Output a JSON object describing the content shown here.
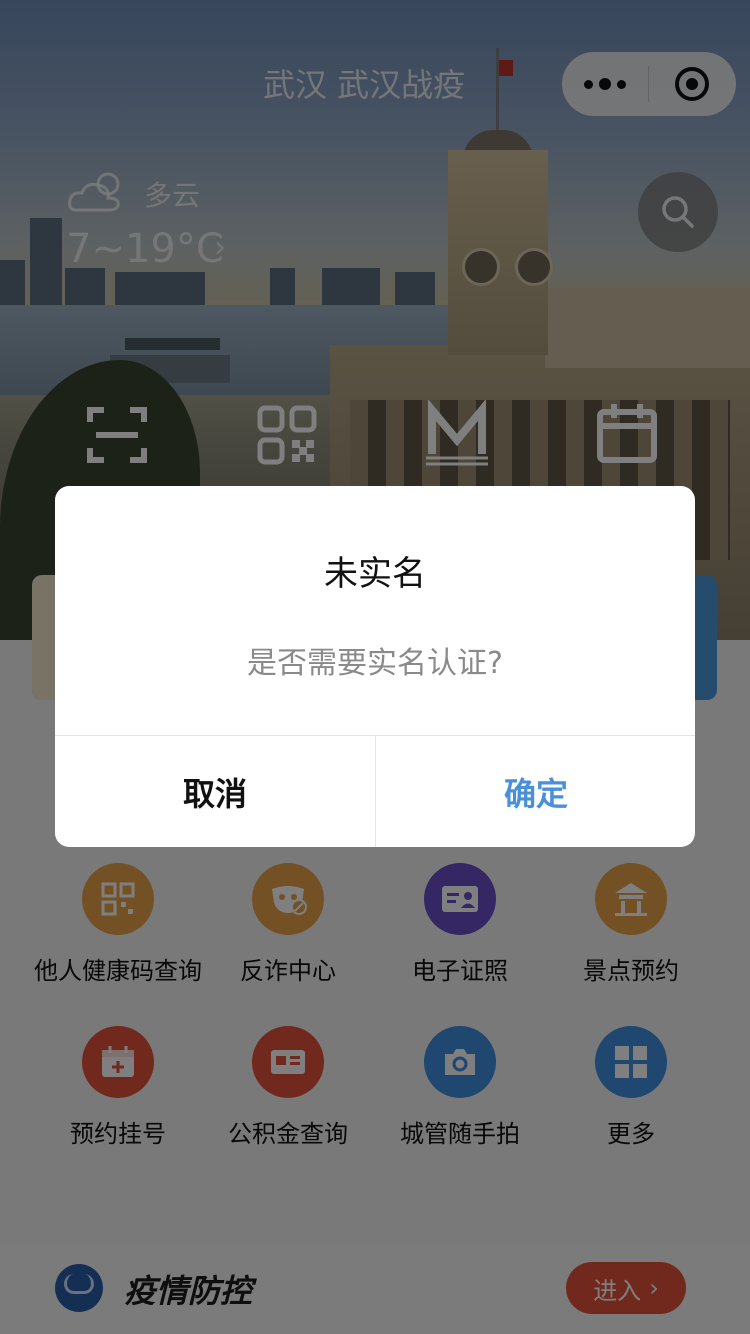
{
  "header": {
    "title": "武汉 武汉战疫"
  },
  "weather": {
    "condition": "多云",
    "temperature": "7~19°C",
    "chevron": "›"
  },
  "quick_icons": [
    "scan-icon",
    "qrcode-icon",
    "metro-icon",
    "calendar-icon"
  ],
  "services": [
    {
      "label": "他人健康码查询",
      "icon": "qrcode-icon",
      "color": "#e8a04a"
    },
    {
      "label": "反诈中心",
      "icon": "mask-icon",
      "color": "#e8a04a"
    },
    {
      "label": "电子证照",
      "icon": "id-card-icon",
      "color": "#6a4fc7"
    },
    {
      "label": "景点预约",
      "icon": "pavilion-icon",
      "color": "#e8a04a"
    },
    {
      "label": "预约挂号",
      "icon": "calendar-plus-icon",
      "color": "#e2533b"
    },
    {
      "label": "公积金查询",
      "icon": "card-icon",
      "color": "#e2533b"
    },
    {
      "label": "城管随手拍",
      "icon": "camera-icon",
      "color": "#3f8fe0"
    },
    {
      "label": "更多",
      "icon": "grid-icon",
      "color": "#3f8fe0"
    }
  ],
  "bottom_bar": {
    "title": "疫情防控",
    "enter_label": "进入",
    "enter_arrow": "›"
  },
  "dialog": {
    "title": "未实名",
    "message": "是否需要实名认证?",
    "cancel_label": "取消",
    "confirm_label": "确定"
  },
  "colors": {
    "accent": "#4a90d9",
    "enter_button": "#e2533b"
  }
}
